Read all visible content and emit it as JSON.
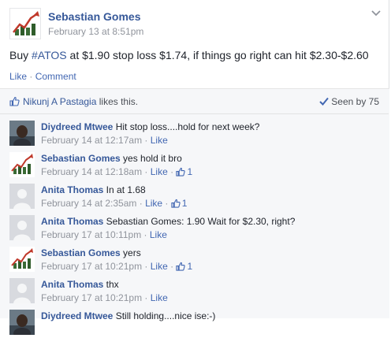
{
  "post": {
    "author": "Sebastian Gomes",
    "time": "February 13 at 8:51pm",
    "text_prefix": "Buy ",
    "hashtag": "#ATOS",
    "text_suffix": " at $1.90 stop loss $1.74, if things go right can hit $2.30-$2.60",
    "actions": {
      "like": "Like",
      "separator": " · ",
      "comment": "Comment"
    },
    "menu_icon": "chevron-down-icon"
  },
  "likes": {
    "who": "Nikunj A Pastagia",
    "suffix": " likes this.",
    "seen": "Seen by 75"
  },
  "comments": [
    {
      "author": "Diydreed Mtwee",
      "text": " Hit stop loss....hold for next week?",
      "time": "February 14 at 12:17am",
      "like": "Like",
      "likes": "",
      "avatar": "photo"
    },
    {
      "author": "Sebastian Gomes",
      "text": " yes hold it bro",
      "time": "February 14 at 12:18am",
      "like": "Like",
      "likes": "1",
      "avatar": "chart"
    },
    {
      "author": "Anita Thomas",
      "text": " In at 1.68",
      "time": "February 14 at 2:35am",
      "like": "Like",
      "likes": "1",
      "avatar": "blank"
    },
    {
      "author": "Anita Thomas",
      "text": " Sebastian Gomes: 1.90 Wait for $2.30, right?",
      "time": "February 17 at 10:11pm",
      "like": "Like",
      "likes": "",
      "avatar": "blank"
    },
    {
      "author": "Sebastian Gomes",
      "text": " yers",
      "time": "February 17 at 10:21pm",
      "like": "Like",
      "likes": "1",
      "avatar": "chart"
    },
    {
      "author": "Anita Thomas",
      "text": " thx",
      "time": "February 17 at 10:21pm",
      "like": "Like",
      "likes": "",
      "avatar": "blank"
    },
    {
      "author": "Diydreed Mtwee",
      "text": " Still holding....nice ise:-)",
      "time": "",
      "like": "",
      "likes": "",
      "avatar": "photo"
    }
  ],
  "ui": {
    "dot": " · "
  }
}
